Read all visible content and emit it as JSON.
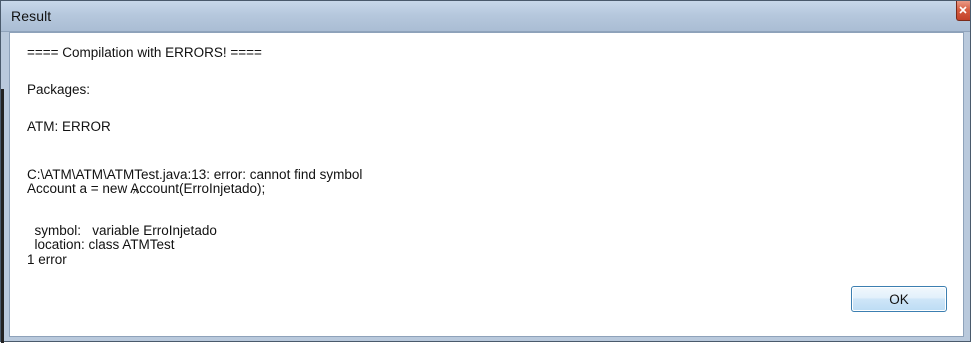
{
  "window": {
    "title": "Result"
  },
  "message": {
    "header": "==== Compilation with ERRORS! ====",
    "packages_label": "Packages:",
    "package_status": "ATM: ERROR",
    "error_lines": [
      "C:\\ATM\\ATM\\ATMTest.java:13: error: cannot find symbol",
      "Account a = new Account(ErroInjetado);"
    ],
    "caret": "^",
    "symbol_lines": [
      "  symbol:   variable ErroInjetado",
      "  location: class ATMTest",
      "1 error"
    ]
  },
  "buttons": {
    "ok_label": "OK"
  },
  "colors": {
    "titlebar": "#b9c9dc",
    "close_button": "#c7432b",
    "ok_border": "#3c7fb1"
  },
  "icons": {
    "close": "close-icon"
  }
}
